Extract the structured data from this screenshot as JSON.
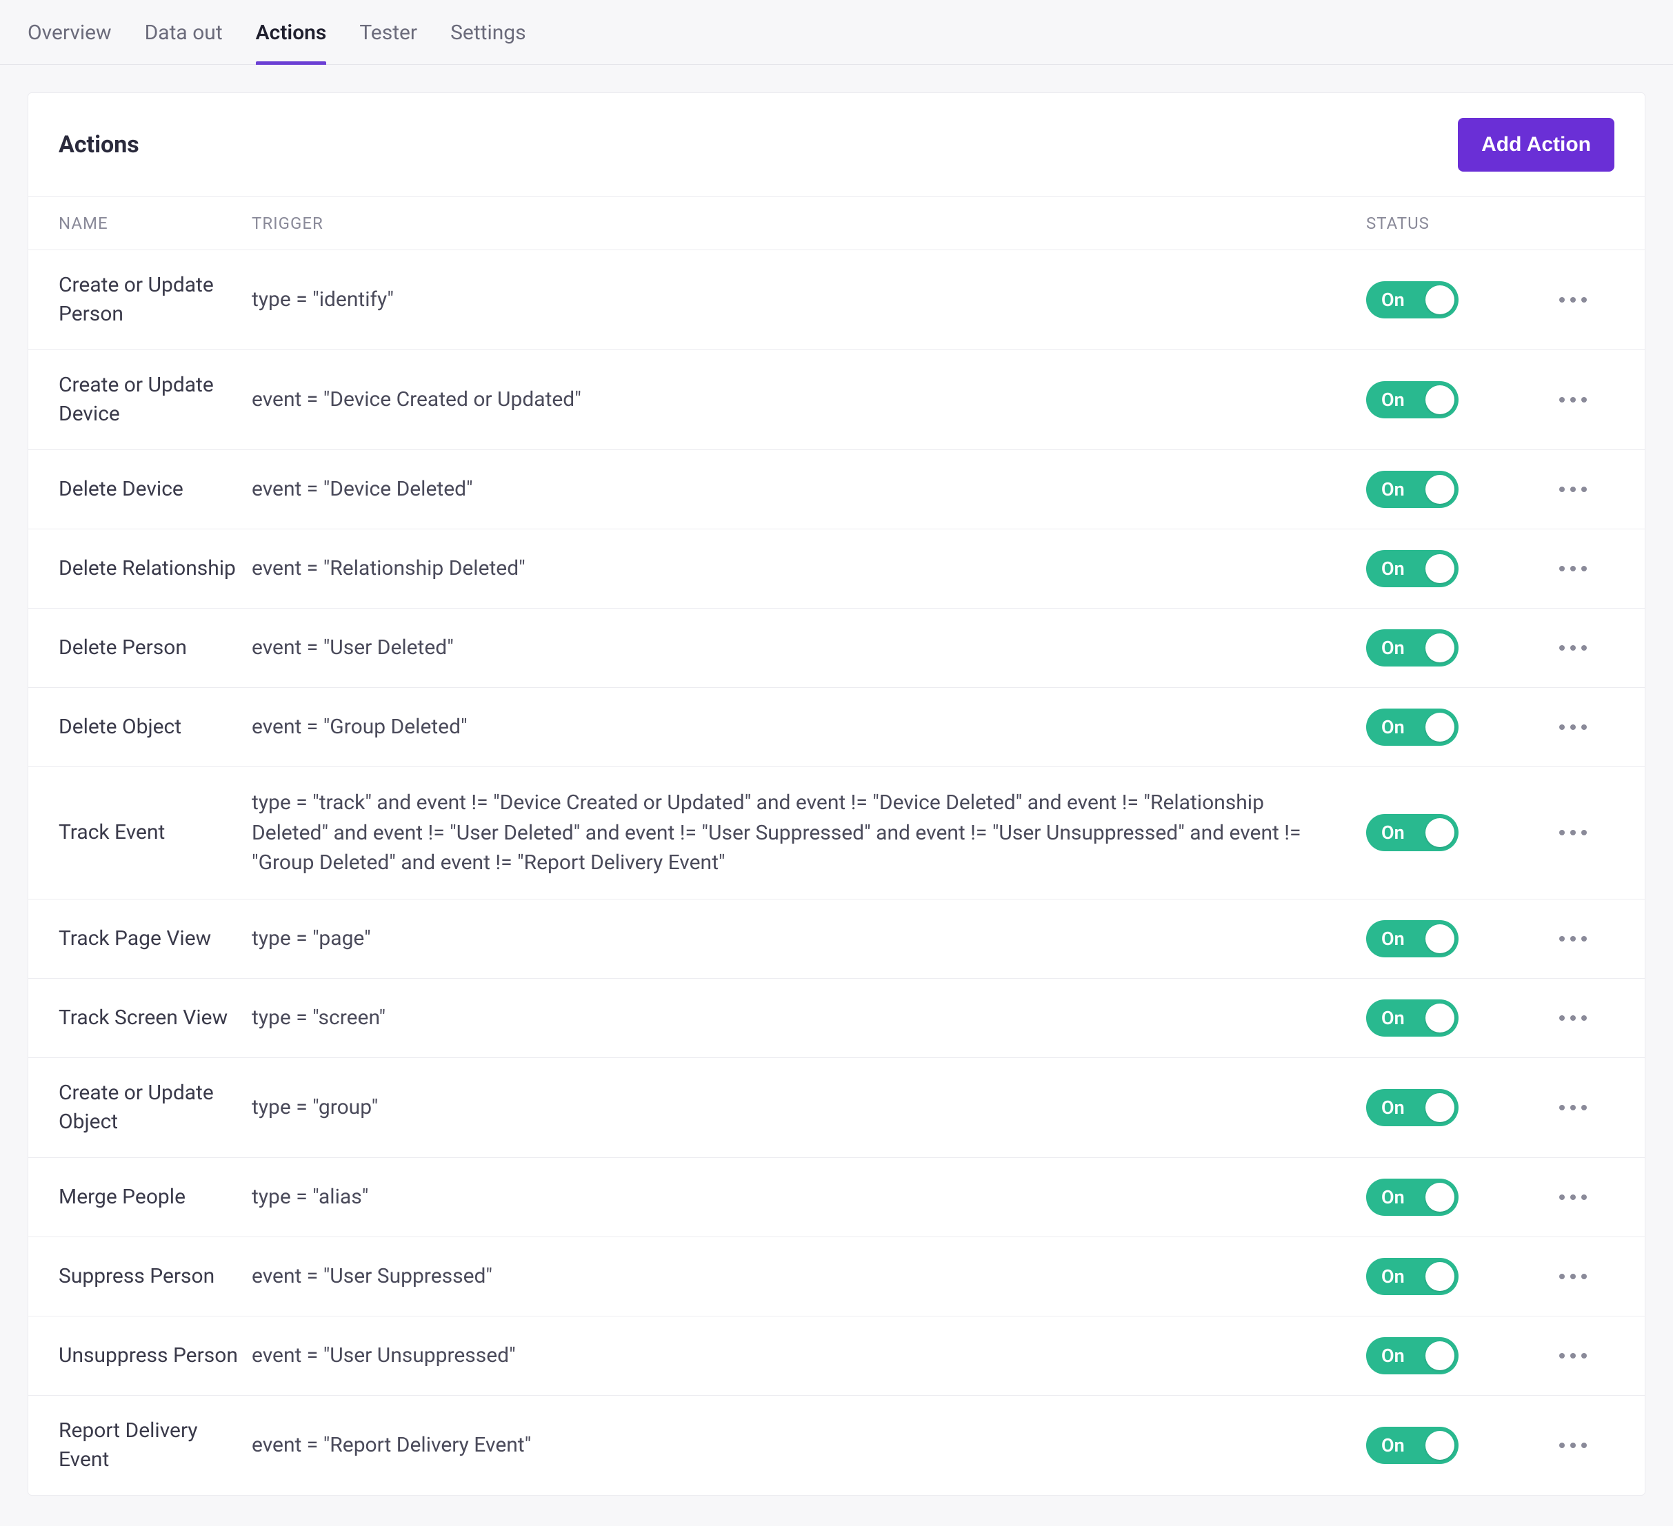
{
  "tabs": [
    {
      "label": "Overview",
      "active": false
    },
    {
      "label": "Data out",
      "active": false
    },
    {
      "label": "Actions",
      "active": true
    },
    {
      "label": "Tester",
      "active": false
    },
    {
      "label": "Settings",
      "active": false
    }
  ],
  "card": {
    "title": "Actions",
    "add_button": "Add Action"
  },
  "columns": {
    "name": "NAME",
    "trigger": "TRIGGER",
    "status": "STATUS"
  },
  "toggle_on_label": "On",
  "actions": [
    {
      "name": "Create or Update Person",
      "trigger": "type = \"identify\"",
      "status": "On"
    },
    {
      "name": "Create or Update Device",
      "trigger": "event = \"Device Created or Updated\"",
      "status": "On"
    },
    {
      "name": "Delete Device",
      "trigger": "event = \"Device Deleted\"",
      "status": "On"
    },
    {
      "name": "Delete Relationship",
      "trigger": "event = \"Relationship Deleted\"",
      "status": "On"
    },
    {
      "name": "Delete Person",
      "trigger": "event = \"User Deleted\"",
      "status": "On"
    },
    {
      "name": "Delete Object",
      "trigger": "event = \"Group Deleted\"",
      "status": "On"
    },
    {
      "name": "Track Event",
      "trigger": "type = \"track\" and event != \"Device Created or Updated\" and event != \"Device Deleted\" and event != \"Relationship Deleted\" and event != \"User Deleted\" and event != \"User Suppressed\" and event != \"User Unsuppressed\" and event != \"Group Deleted\" and event != \"Report Delivery Event\"",
      "status": "On"
    },
    {
      "name": "Track Page View",
      "trigger": "type = \"page\"",
      "status": "On"
    },
    {
      "name": "Track Screen View",
      "trigger": "type = \"screen\"",
      "status": "On"
    },
    {
      "name": "Create or Update Object",
      "trigger": "type = \"group\"",
      "status": "On"
    },
    {
      "name": "Merge People",
      "trigger": "type = \"alias\"",
      "status": "On"
    },
    {
      "name": "Suppress Person",
      "trigger": "event = \"User Suppressed\"",
      "status": "On"
    },
    {
      "name": "Unsuppress Person",
      "trigger": "event = \"User Unsuppressed\"",
      "status": "On"
    },
    {
      "name": "Report Delivery Event",
      "trigger": "event = \"Report Delivery Event\"",
      "status": "On"
    }
  ]
}
